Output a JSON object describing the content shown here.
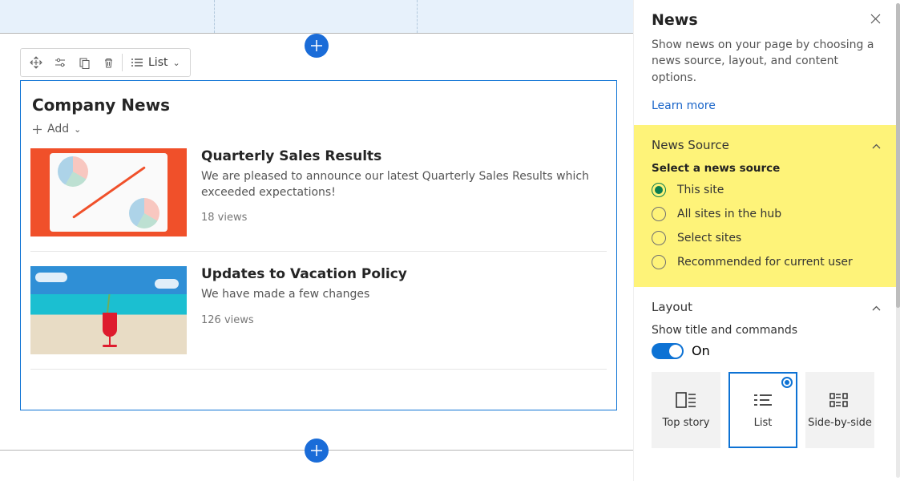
{
  "canvas": {
    "toolbar": {
      "list_label": "List"
    },
    "webpart": {
      "title": "Company News",
      "add_label": "Add",
      "items": [
        {
          "title": "Quarterly Sales Results",
          "desc": "We are pleased to announce our latest Quarterly Sales Results which exceeded expectations!",
          "views": "18 views"
        },
        {
          "title": "Updates to Vacation Policy",
          "desc": "We have made a few changes",
          "views": "126 views"
        }
      ]
    }
  },
  "panel": {
    "title": "News",
    "description": "Show news on your page by choosing a news source, layout, and content options.",
    "learn_more": "Learn more",
    "source": {
      "heading": "News Source",
      "sub": "Select a news source",
      "options": [
        "This site",
        "All sites in the hub",
        "Select sites",
        "Recommended for current user"
      ]
    },
    "layout": {
      "heading": "Layout",
      "show_title_label": "Show title and commands",
      "toggle_label": "On",
      "tiles": [
        "Top story",
        "List",
        "Side-by-side"
      ]
    }
  }
}
